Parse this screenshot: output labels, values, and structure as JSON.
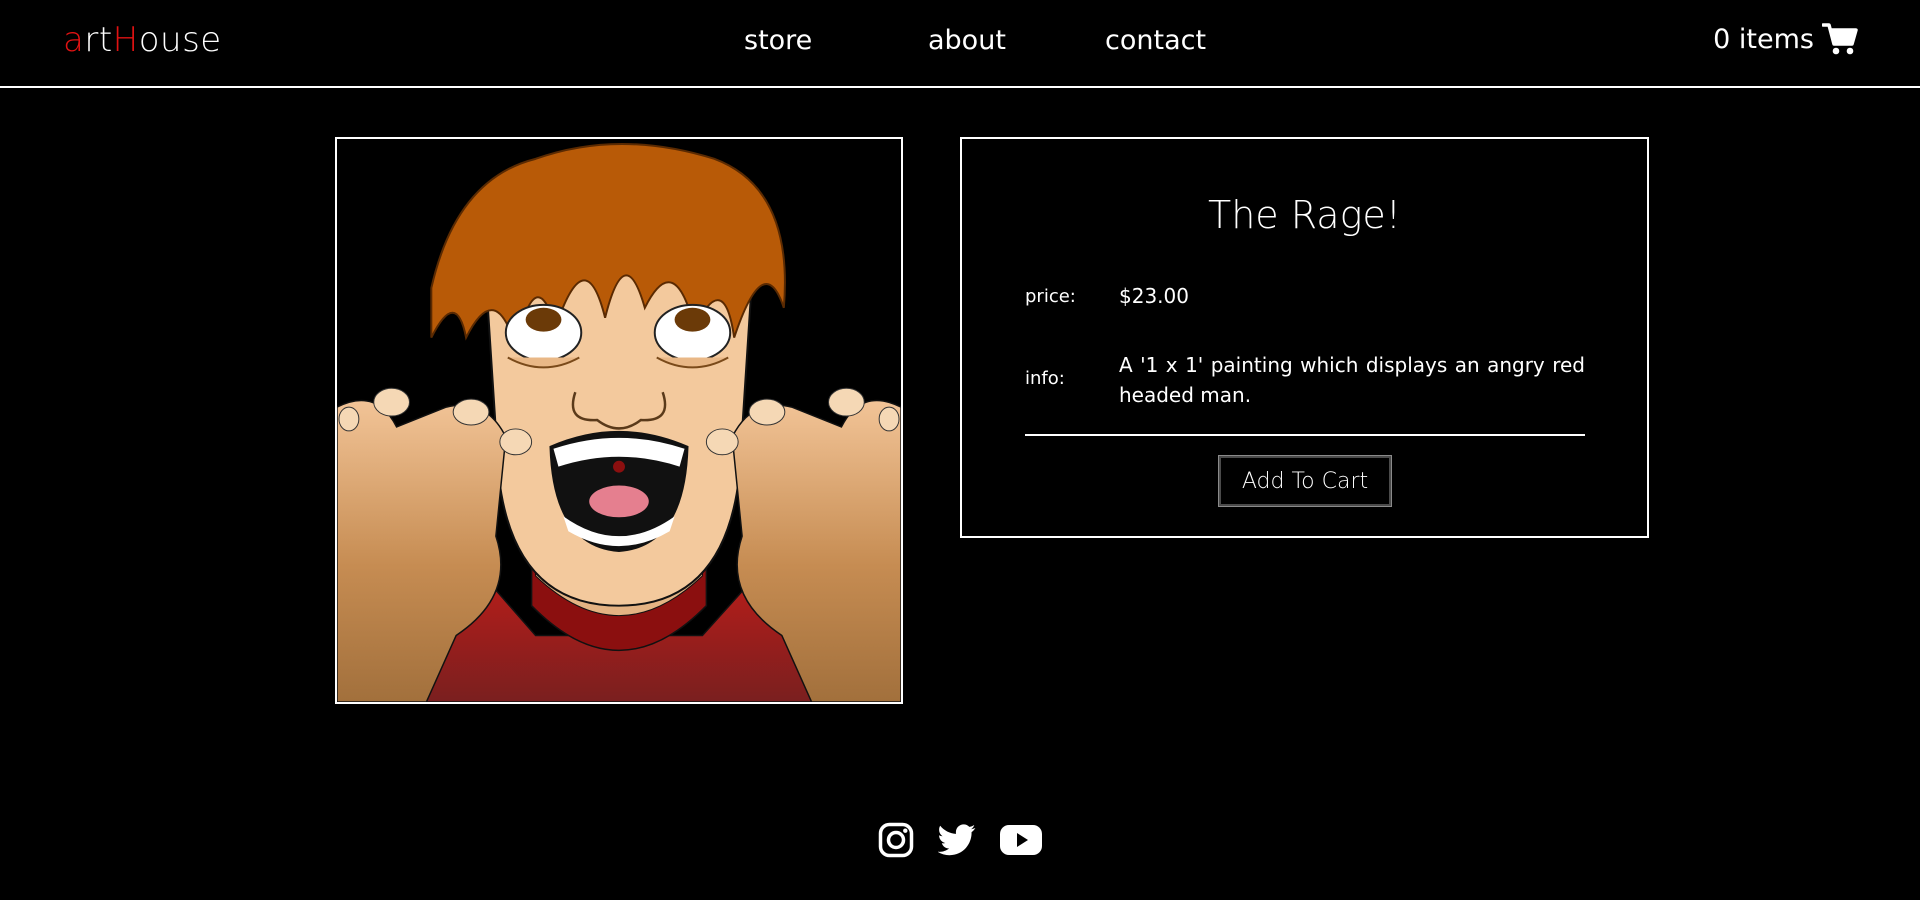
{
  "brand": {
    "parts": [
      {
        "text": "a",
        "accent": true
      },
      {
        "text": "rt",
        "accent": false
      },
      {
        "text": "H",
        "accent": true
      },
      {
        "text": "ouse",
        "accent": false
      }
    ],
    "accent_color": "#e01212"
  },
  "nav": {
    "store": "store",
    "about": "about",
    "contact": "contact"
  },
  "cart": {
    "label": "0 items",
    "icon": "cart-icon"
  },
  "product": {
    "title": "The Rage!",
    "price_label": "price:",
    "price": "$23.00",
    "info_label": "info:",
    "info": "A '1 x 1' painting which displays an angry red headed man.",
    "add_button": "Add To Cart",
    "image_alt": "The Rage!"
  },
  "footer": {
    "social": [
      "instagram-icon",
      "twitter-icon",
      "youtube-icon"
    ]
  }
}
